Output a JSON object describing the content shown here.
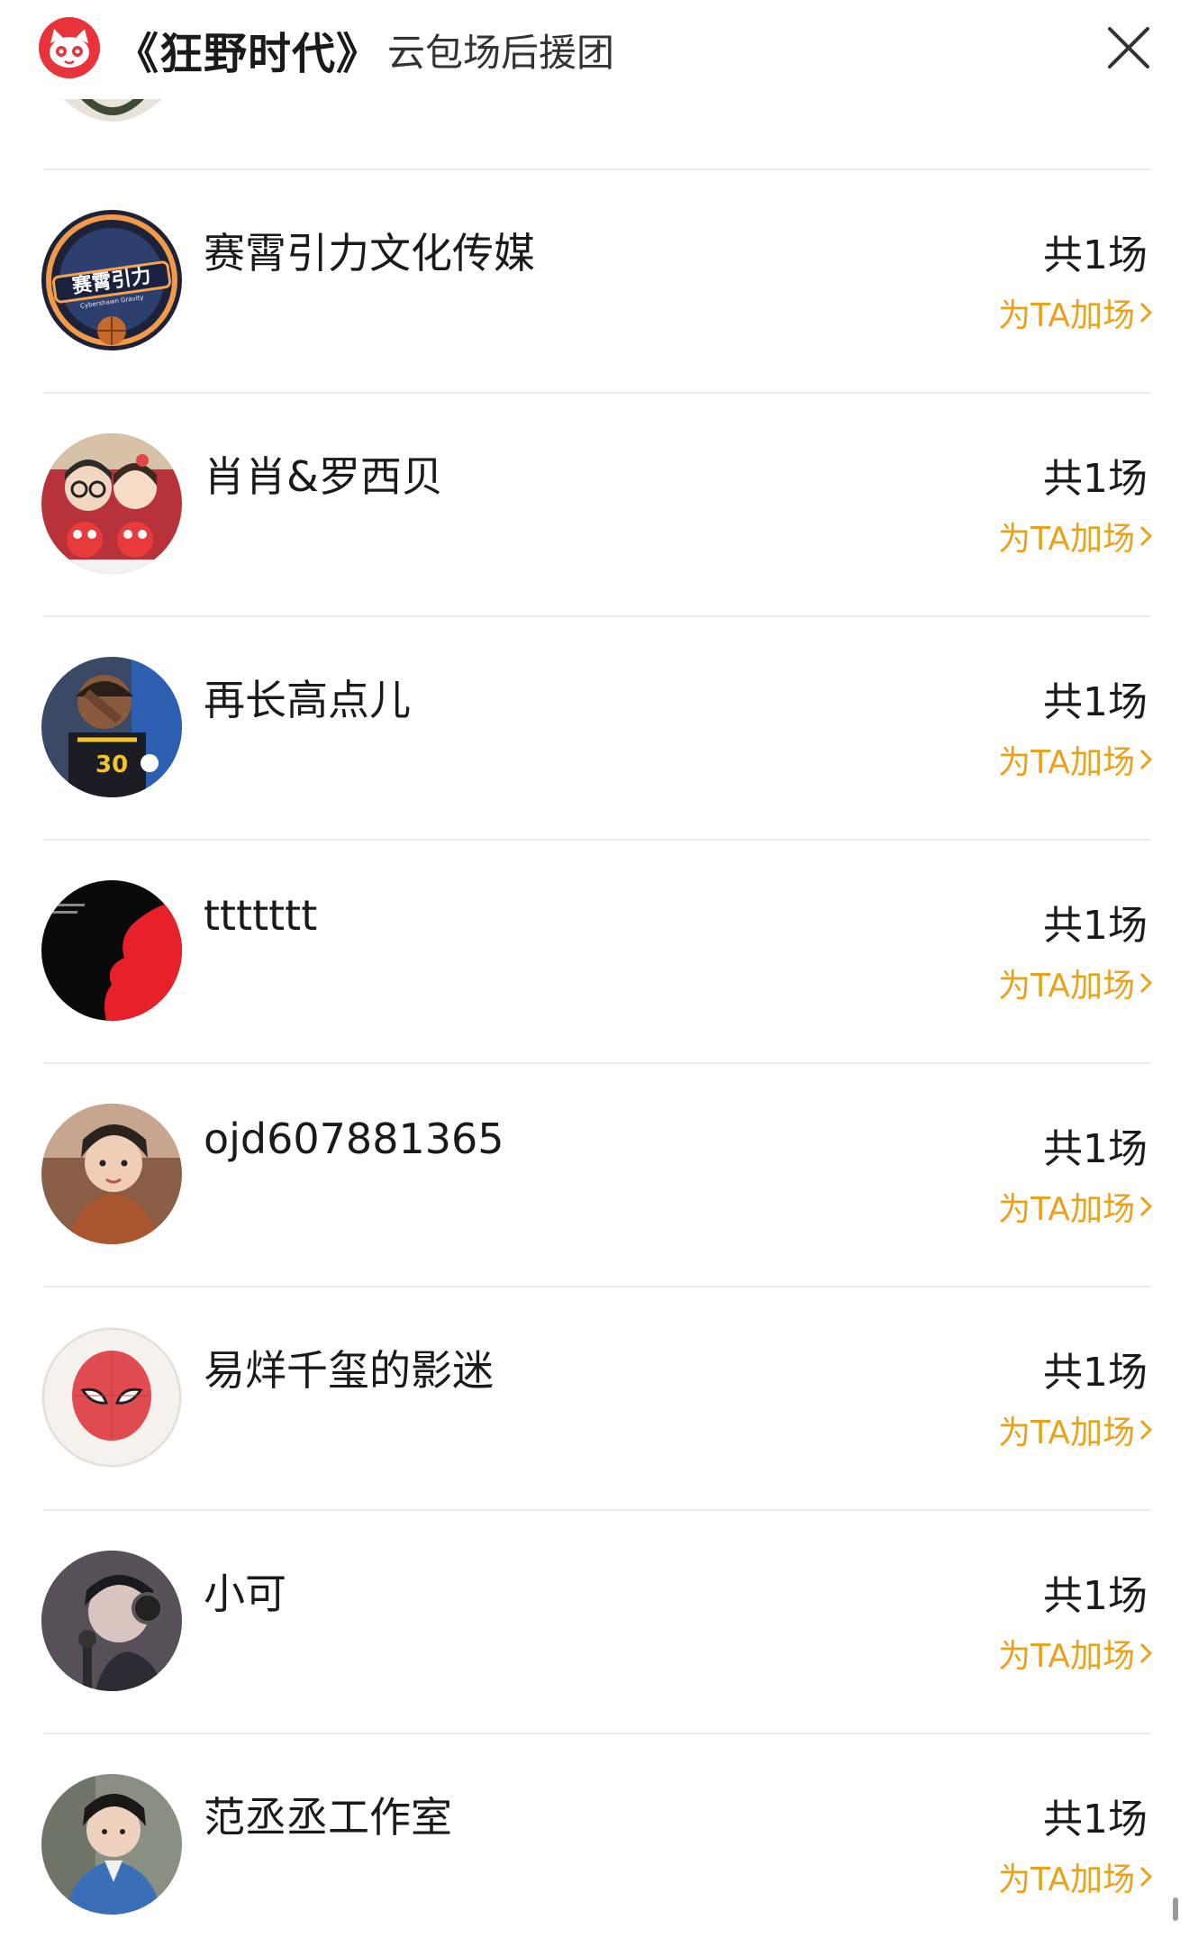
{
  "header": {
    "logo_icon": "maoyan-cat-logo",
    "film_title": "《狂野时代》",
    "subtitle": "云包场后援团",
    "close_icon": "close-x-icon"
  },
  "colors": {
    "accent": "#e8a21c",
    "logo": "#e8333a",
    "divider": "#ececec"
  },
  "list": [
    {
      "name": "赛霄引力文化传媒",
      "count": "共1场",
      "boost": "为TA加场",
      "avatar_text": "赛霄引力",
      "avatar_caption": "Cybershawn Gravity"
    },
    {
      "name": "肖肖&罗西贝",
      "count": "共1场",
      "boost": "为TA加场"
    },
    {
      "name": "再长高点儿",
      "count": "共1场",
      "boost": "为TA加场"
    },
    {
      "name": "ttttttt",
      "count": "共1场",
      "boost": "为TA加场"
    },
    {
      "name": "ojd607881365",
      "count": "共1场",
      "boost": "为TA加场"
    },
    {
      "name": "易烊千玺的影迷",
      "count": "共1场",
      "boost": "为TA加场"
    },
    {
      "name": "小可",
      "count": "共1场",
      "boost": "为TA加场"
    },
    {
      "name": "范丞丞工作室",
      "count": "共1场",
      "boost": "为TA加场"
    }
  ]
}
